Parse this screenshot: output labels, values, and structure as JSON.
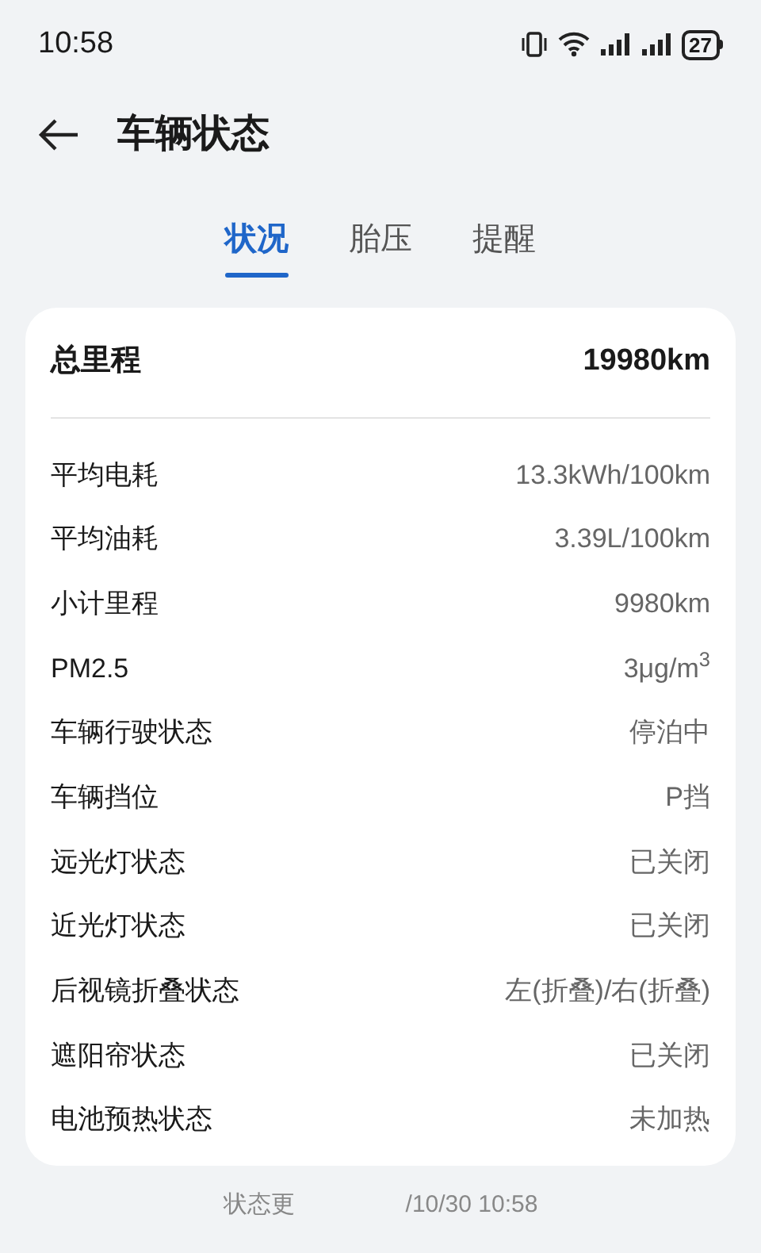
{
  "status_bar": {
    "time": "10:58",
    "battery": "27"
  },
  "header": {
    "title": "车辆状态"
  },
  "tabs": [
    {
      "label": "状况",
      "selected": true
    },
    {
      "label": "胎压",
      "selected": false
    },
    {
      "label": "提醒",
      "selected": false
    }
  ],
  "summary": {
    "label": "总里程",
    "value": "19980km"
  },
  "rows": [
    {
      "label": "平均电耗",
      "value": "13.3kWh/100km"
    },
    {
      "label": "平均油耗",
      "value": "3.39L/100km"
    },
    {
      "label": "小计里程",
      "value": "9980km"
    },
    {
      "label": "PM2.5",
      "value": "3μg/m$^{3}$"
    },
    {
      "label": "车辆行驶状态",
      "value": "停泊中"
    },
    {
      "label": "车辆挡位",
      "value": "P挡"
    },
    {
      "label": "远光灯状态",
      "value": "已关闭"
    },
    {
      "label": "近光灯状态",
      "value": "已关闭"
    },
    {
      "label": "后视镜折叠状态",
      "value": "左(折叠)/右(折叠)"
    },
    {
      "label": "遮阳帘状态",
      "value": "已关闭"
    },
    {
      "label": "电池预热状态",
      "value": "未加热"
    }
  ],
  "footer": [
    "状态更",
    "/10/30 10:58"
  ]
}
